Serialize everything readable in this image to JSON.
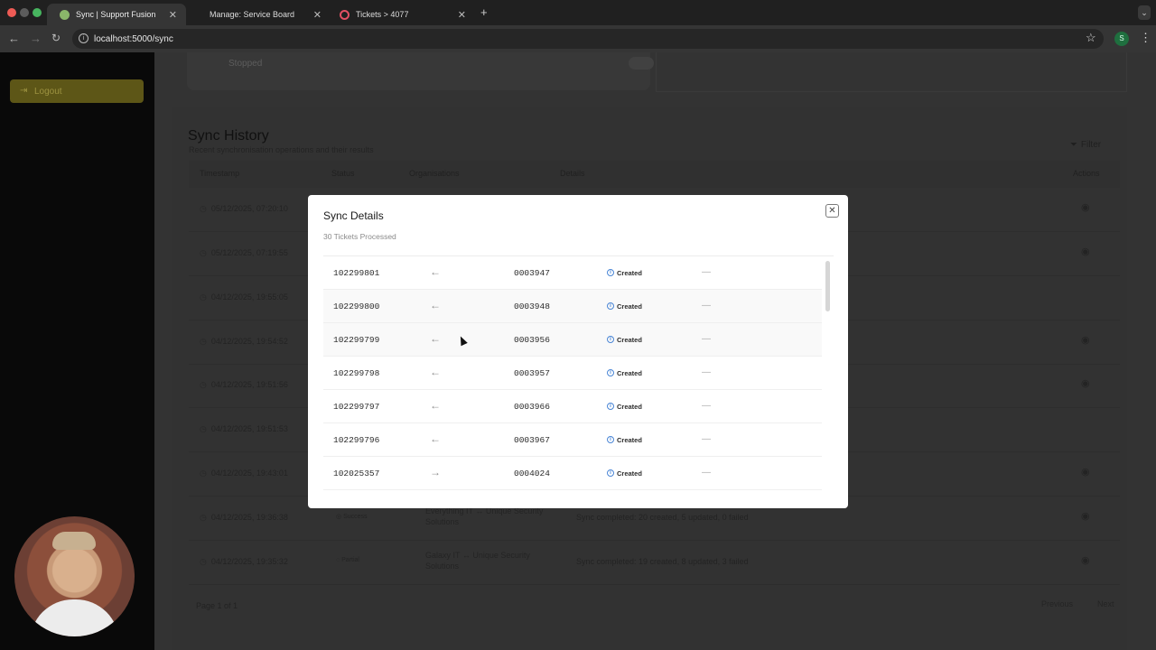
{
  "browser": {
    "tabs": [
      {
        "label": "Sync | Support Fusion",
        "active": true
      },
      {
        "label": "Manage: Service Board",
        "active": false
      },
      {
        "label": "Tickets > 4077",
        "active": false
      }
    ],
    "url": "localhost:5000/sync",
    "profile_initial": "S"
  },
  "sidebar": {
    "logout_label": "Logout"
  },
  "top_card": {
    "status_label": "Stopped"
  },
  "history": {
    "title": "Sync History",
    "subtitle": "Recent synchronisation operations and their results",
    "filter_label": "Filter",
    "columns": {
      "timestamp": "Timestamp",
      "status": "Status",
      "organisations": "Organisations",
      "details": "Details",
      "actions": "Actions"
    },
    "rows": [
      {
        "timestamp": "05/12/2025, 07:20:10",
        "status": "",
        "organisations": "",
        "details": "",
        "has_view": true
      },
      {
        "timestamp": "05/12/2025, 07:19:55",
        "status": "",
        "organisations": "",
        "details": "",
        "has_view": true
      },
      {
        "timestamp": "04/12/2025, 19:55:05",
        "status": "",
        "organisations": "",
        "details": "",
        "has_view": false
      },
      {
        "timestamp": "04/12/2025, 19:54:52",
        "status": "",
        "organisations": "",
        "details": "",
        "has_view": true
      },
      {
        "timestamp": "04/12/2025, 19:51:56",
        "status": "",
        "organisations": "",
        "details": "",
        "has_view": true
      },
      {
        "timestamp": "04/12/2025, 19:51:53",
        "status": "",
        "organisations": "",
        "details": "",
        "has_view": false
      },
      {
        "timestamp": "04/12/2025, 19:43:01",
        "status": "",
        "organisations": "",
        "details": "",
        "has_view": true
      },
      {
        "timestamp": "04/12/2025, 19:36:38",
        "status": "Success",
        "organisations": "Everything IT ↔ Unique Security Solutions",
        "details": "Sync completed: 20 created, 5 updated, 0 failed",
        "has_view": true
      },
      {
        "timestamp": "04/12/2025, 19:35:32",
        "status": "Partial",
        "organisations": "Galaxy IT ↔ Unique Security Solutions",
        "details": "Sync completed: 19 created, 8 updated, 3 failed",
        "has_view": true
      }
    ],
    "pagination": {
      "page_text": "Page 1 of 1",
      "previous": "Previous",
      "next": "Next"
    }
  },
  "modal": {
    "title": "Sync Details",
    "subtitle": "30 Tickets Processed",
    "items": [
      {
        "source": "102299801",
        "arrow": "←",
        "target": "0003947",
        "status": "Created",
        "note": "—"
      },
      {
        "source": "102299800",
        "arrow": "←",
        "target": "0003948",
        "status": "Created",
        "note": "—"
      },
      {
        "source": "102299799",
        "arrow": "←",
        "target": "0003956",
        "status": "Created",
        "note": "—"
      },
      {
        "source": "102299798",
        "arrow": "←",
        "target": "0003957",
        "status": "Created",
        "note": "—"
      },
      {
        "source": "102299797",
        "arrow": "←",
        "target": "0003966",
        "status": "Created",
        "note": "—"
      },
      {
        "source": "102299796",
        "arrow": "←",
        "target": "0003967",
        "status": "Created",
        "note": "—"
      },
      {
        "source": "102025357",
        "arrow": "→",
        "target": "0004024",
        "status": "Created",
        "note": "—"
      }
    ]
  },
  "colors": {
    "accent": "#5d5617",
    "modal_bg": "#ffffff",
    "overlay": "#333333",
    "info_blue": "#4a86d6"
  }
}
